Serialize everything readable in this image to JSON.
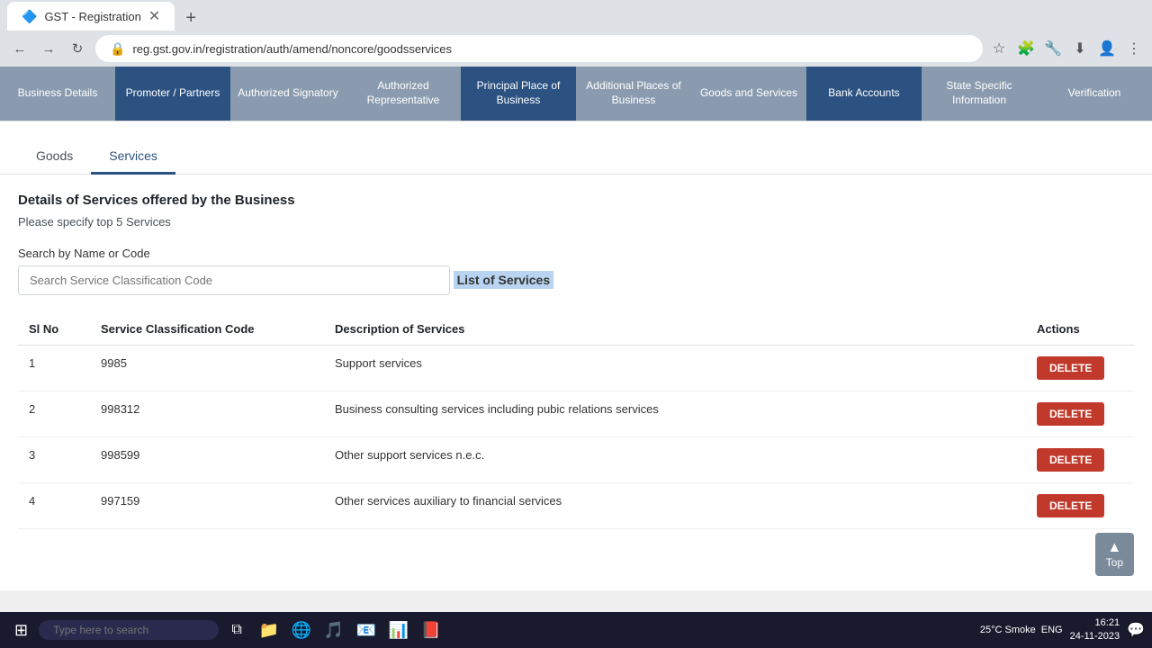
{
  "browser": {
    "tab_title": "GST - Registration",
    "url": "reg.gst.gov.in/registration/auth/amend/noncore/goodsservices",
    "back_btn": "←",
    "forward_btn": "→",
    "refresh_btn": "↻"
  },
  "nav_tabs": [
    {
      "id": "business-details",
      "label": "Business Details",
      "active": false,
      "color": "gray"
    },
    {
      "id": "promoter-partners",
      "label": "Promoter / Partners",
      "active": false,
      "color": "blue-dark"
    },
    {
      "id": "authorized-signatory",
      "label": "Authorized Signatory",
      "active": false,
      "color": "gray"
    },
    {
      "id": "authorized-representative",
      "label": "Authorized Representative",
      "active": false,
      "color": "gray"
    },
    {
      "id": "principal-place",
      "label": "Principal Place of Business",
      "active": true,
      "color": "blue-dark"
    },
    {
      "id": "additional-places",
      "label": "Additional Places of Business",
      "active": false,
      "color": "gray"
    },
    {
      "id": "goods-services",
      "label": "Goods and Services",
      "active": false,
      "color": "gray"
    },
    {
      "id": "bank-accounts",
      "label": "Bank Accounts",
      "active": false,
      "color": "blue-dark"
    },
    {
      "id": "state-specific",
      "label": "State Specific Information",
      "active": false,
      "color": "gray"
    },
    {
      "id": "verification",
      "label": "Verification",
      "active": false,
      "color": "gray"
    }
  ],
  "inner_tabs": [
    {
      "id": "goods",
      "label": "Goods",
      "active": false
    },
    {
      "id": "services",
      "label": "Services",
      "active": true
    }
  ],
  "section": {
    "title": "Details of Services offered by the Business",
    "subtitle": "Please specify top 5 Services"
  },
  "search": {
    "label": "Search by Name or Code",
    "placeholder": "Search Service Classification Code"
  },
  "list_title": "List of Services",
  "table": {
    "headers": [
      "Sl No",
      "Service Classification Code",
      "Description of Services",
      "Actions"
    ],
    "rows": [
      {
        "sl": "1",
        "code": "9985",
        "description": "Support services",
        "action": "DELETE"
      },
      {
        "sl": "2",
        "code": "998312",
        "description": "Business consulting services including pubic relations services",
        "action": "DELETE"
      },
      {
        "sl": "3",
        "code": "998599",
        "description": "Other support services n.e.c.",
        "action": "DELETE"
      },
      {
        "sl": "4",
        "code": "997159",
        "description": "Other services auxiliary to financial services",
        "action": "DELETE"
      }
    ]
  },
  "top_btn": {
    "arrow": "▲",
    "label": "Top"
  },
  "taskbar": {
    "search_placeholder": "Type here to search",
    "weather": "25°C  Smoke",
    "language": "ENG",
    "time": "16:21",
    "date": "24-11-2023"
  }
}
